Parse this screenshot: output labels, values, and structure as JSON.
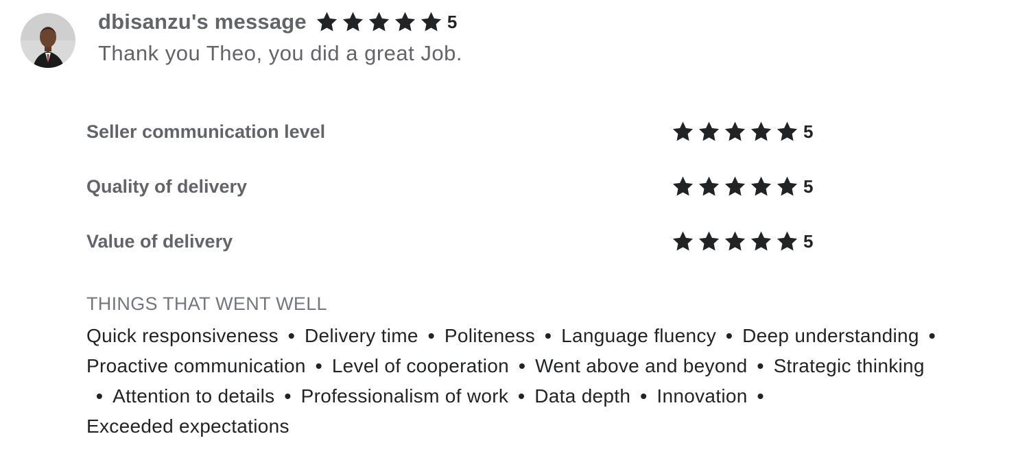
{
  "review": {
    "username": "dbisanzu's message",
    "overall_rating": 5,
    "overall_score": "5",
    "message": "Thank you Theo, you did a great Job."
  },
  "ratings": [
    {
      "label": "Seller communication level",
      "value": 5,
      "score": "5"
    },
    {
      "label": "Quality of delivery",
      "value": 5,
      "score": "5"
    },
    {
      "label": "Value of delivery",
      "value": 5,
      "score": "5"
    }
  ],
  "went_well": {
    "title": "THINGS THAT WENT WELL",
    "items": [
      "Quick responsiveness",
      "Delivery time",
      "Politeness",
      "Language fluency",
      "Deep understanding",
      "Proactive communication",
      "Level of cooperation",
      "Went above and beyond",
      "Strategic thinking",
      "Attention to details",
      "Professionalism of work",
      "Data depth",
      "Innovation",
      "Exceeded expectations"
    ],
    "separator": "•"
  },
  "icons": {
    "star": "star-icon",
    "avatar": "user-avatar"
  },
  "colors": {
    "star": "#222325",
    "label": "#62646a",
    "text": "#222325"
  }
}
